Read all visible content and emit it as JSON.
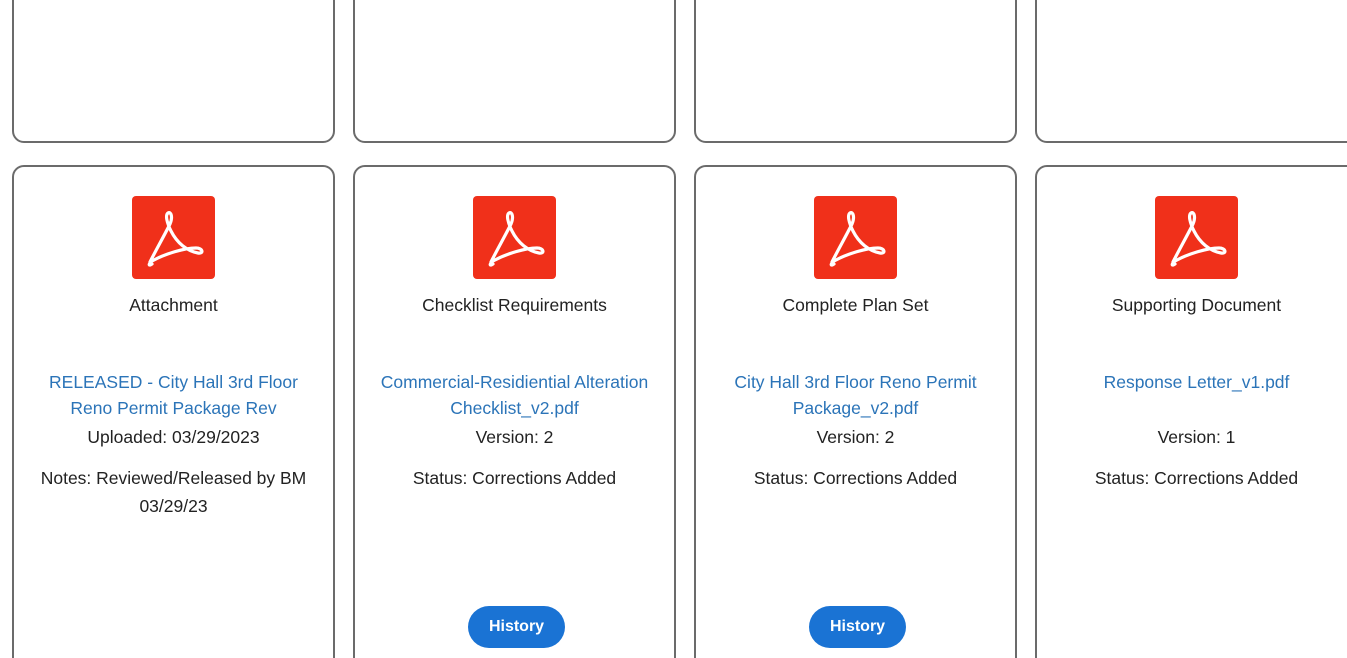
{
  "colors": {
    "card_border": "#6b6b6b",
    "pdf_red": "#f0301a",
    "link_blue": "#2b74b8",
    "button_blue": "#1a73d4"
  },
  "icons": {
    "document": "pdf-icon"
  },
  "cards": [
    {
      "doc_type": "Attachment",
      "file_name": "RELEASED - City Hall 3rd Floor Reno Permit Package Rev",
      "line1": "Uploaded: 03/29/2023",
      "line2": "Notes: Reviewed/Released by BM 03/29/23",
      "history_label": ""
    },
    {
      "doc_type": "Checklist Requirements",
      "file_name": "Commercial-Residiential Alteration Checklist_v2.pdf",
      "line1": "Version: 2",
      "line2": "Status: Corrections Added",
      "history_label": "History"
    },
    {
      "doc_type": "Complete Plan Set",
      "file_name": "City Hall 3rd Floor Reno Permit Package_v2.pdf",
      "line1": "Version: 2",
      "line2": "Status: Corrections Added",
      "history_label": "History"
    },
    {
      "doc_type": "Supporting Document",
      "file_name": "Response Letter_v1.pdf",
      "line1": "Version: 1",
      "line2": "Status: Corrections Added",
      "history_label": ""
    }
  ]
}
